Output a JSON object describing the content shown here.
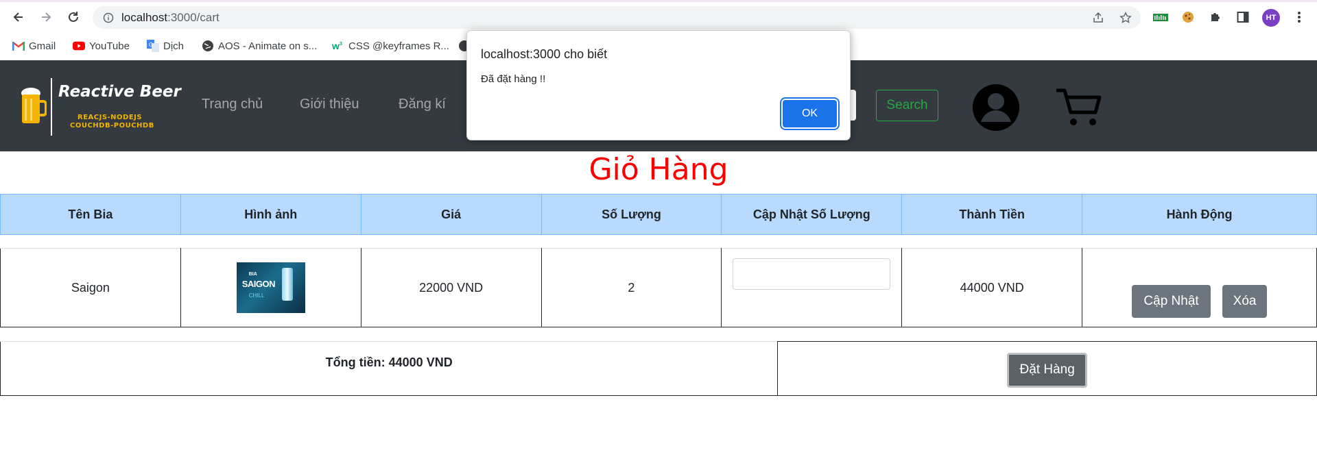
{
  "browser": {
    "url_host": "localhost",
    "url_path": ":3000/cart",
    "profile_initials": "HT",
    "bookmarks": [
      "Gmail",
      "YouTube",
      "Dịch",
      "AOS - Animate on s...",
      "CSS @keyframes R..."
    ]
  },
  "site": {
    "logo_title": "Reactive Beer",
    "logo_sub1": "REACJS-NODEJS",
    "logo_sub2": "COUCHDB-POUCHDB",
    "nav": [
      "Trang chủ",
      "Giới thiệu",
      "Đăng kí"
    ],
    "search_label": "Search"
  },
  "cart": {
    "title": "Giỏ Hàng",
    "headers": [
      "Tên Bia",
      "Hình ảnh",
      "Giá",
      "Số Lượng",
      "Cập Nhật Số Lượng",
      "Thành Tiền",
      "Hành Động"
    ],
    "items": [
      {
        "name": "Saigon",
        "image_text": {
          "line1": "BIA",
          "line2": "SAIGON",
          "line3": "CHILL"
        },
        "price": "22000 VND",
        "quantity": "2",
        "qty_input": "",
        "subtotal": "44000 VND",
        "update_label": "Cập Nhật",
        "delete_label": "Xóa"
      }
    ],
    "total_text": "Tổng tiền: 44000 VND",
    "order_label": "Đặt Hàng"
  },
  "dialog": {
    "title": "localhost:3000 cho biết",
    "message": "Đã đặt hàng !!",
    "ok_label": "OK"
  },
  "colors": {
    "navbar": "#343a40",
    "title_red": "#ff0000",
    "header_blue": "#b8daff",
    "search_green": "#28a745",
    "button_gray": "#6c757d",
    "dialog_blue": "#1a73e8"
  }
}
